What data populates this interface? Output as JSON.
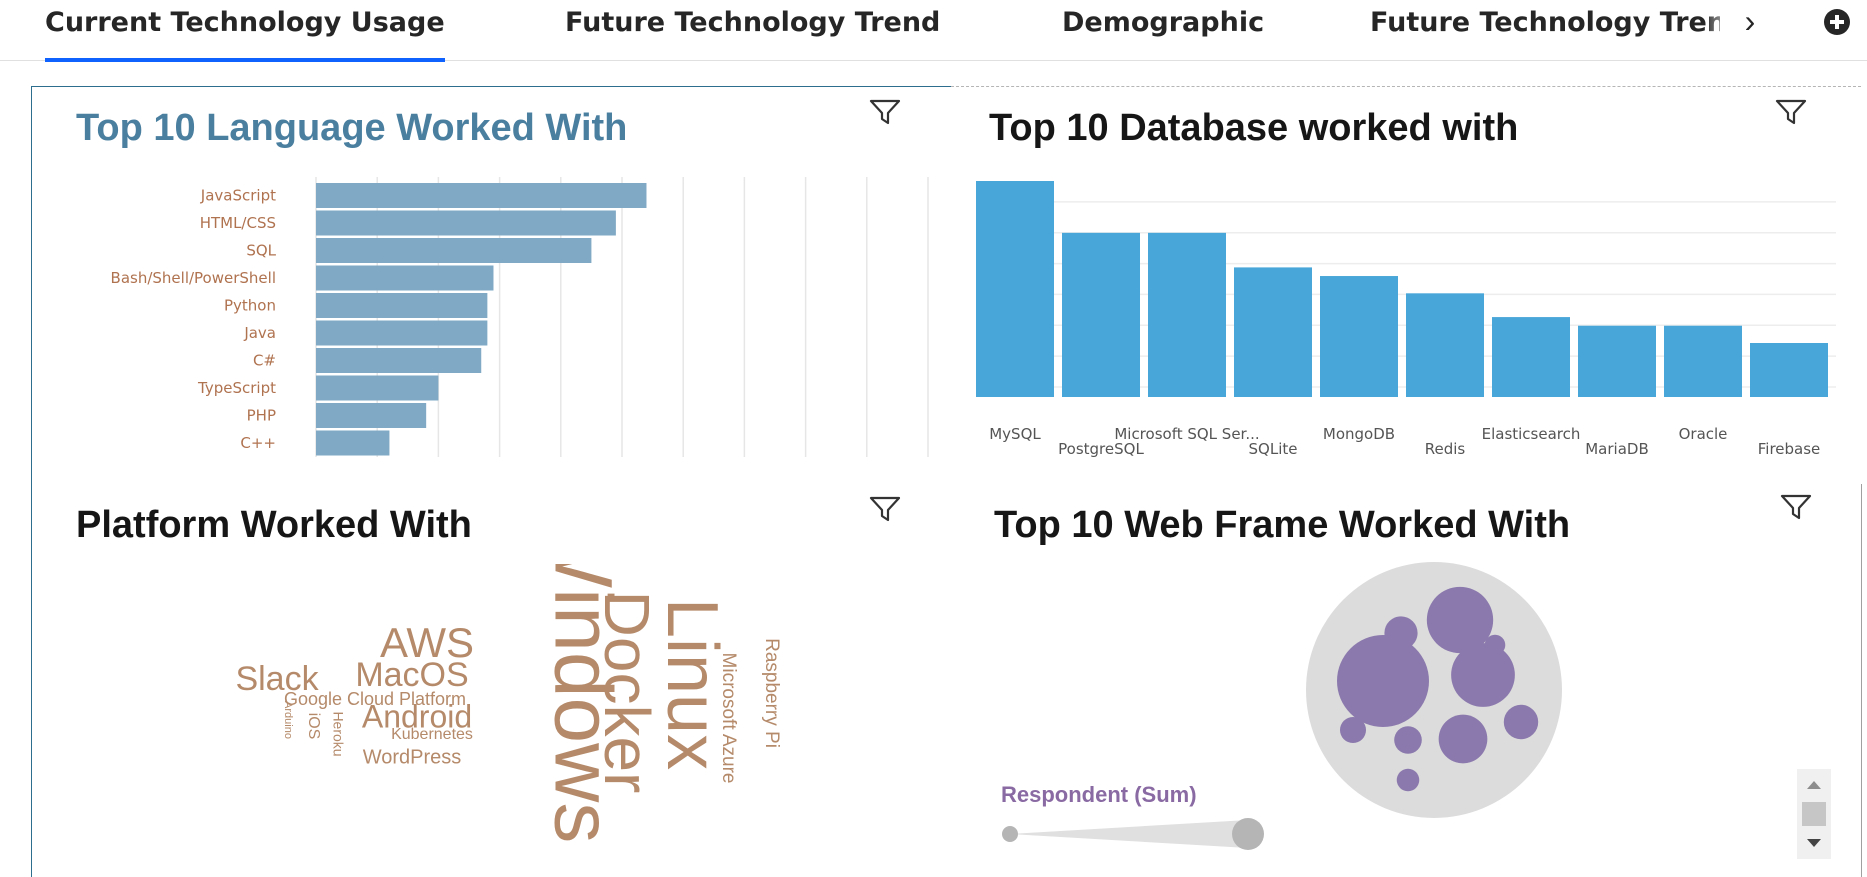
{
  "tabs": [
    {
      "label": "Current Technology Usage",
      "active": true
    },
    {
      "label": "Future Technology Trend",
      "active": false
    },
    {
      "label": "Demographic",
      "active": false
    },
    {
      "label": "Future Technology Trend",
      "active": false
    }
  ],
  "tab_controls": {
    "next_icon": "chevron-right-icon",
    "add_icon": "plus-circle-icon"
  },
  "panels": {
    "languages": {
      "title": "Top 10 Language Worked With",
      "title_color": "#4a7fa0"
    },
    "databases": {
      "title": "Top 10 Database worked with"
    },
    "platforms": {
      "title": "Platform Worked With"
    },
    "webframes": {
      "title": "Top 10 Web Frame Worked With",
      "slider_label": "Respondent (Sum)"
    }
  },
  "colors": {
    "bar_lang": "#7fa9c4",
    "bar_db": "#48a6d8",
    "wordcloud": "#b58a6a",
    "bubble": "#8b79ad",
    "pack_bg": "#dcdcdc",
    "tick_label": "#b07350"
  },
  "chart_data": [
    {
      "type": "bar",
      "orientation": "horizontal",
      "title": "Top 10 Language Worked With",
      "categories": [
        "JavaScript",
        "HTML/CSS",
        "SQL",
        "Bash/Shell/PowerShell",
        "Python",
        "Java",
        "C#",
        "TypeScript",
        "PHP",
        "C++"
      ],
      "values": [
        54,
        49,
        45,
        29,
        28,
        28,
        27,
        20,
        18,
        12
      ],
      "xlim": [
        0,
        100
      ],
      "grid": true
    },
    {
      "type": "bar",
      "title": "Top 10 Database worked with",
      "categories": [
        "MySQL",
        "PostgreSQL",
        "Microsoft SQL Ser...",
        "SQLite",
        "MongoDB",
        "Redis",
        "Elasticsearch",
        "MariaDB",
        "Oracle",
        "Firebase"
      ],
      "values": [
        100,
        76,
        76,
        60,
        56,
        48,
        37,
        33,
        33,
        25
      ],
      "ylim": [
        0,
        100
      ],
      "grid": true
    },
    {
      "type": "wordcloud",
      "title": "Platform Worked With",
      "words": [
        {
          "text": "Windows",
          "weight": 100
        },
        {
          "text": "Linux",
          "weight": 88
        },
        {
          "text": "Docker",
          "weight": 80
        },
        {
          "text": "AWS",
          "weight": 52
        },
        {
          "text": "MacOS",
          "weight": 45
        },
        {
          "text": "Slack",
          "weight": 44
        },
        {
          "text": "Android",
          "weight": 42
        },
        {
          "text": "Google Cloud Platform",
          "weight": 24
        },
        {
          "text": "Microsoft Azure",
          "weight": 24
        },
        {
          "text": "Raspberry Pi",
          "weight": 24
        },
        {
          "text": "WordPress",
          "weight": 25
        },
        {
          "text": "Kubernetes",
          "weight": 20
        },
        {
          "text": "iOS",
          "weight": 20
        },
        {
          "text": "Heroku",
          "weight": 17
        },
        {
          "text": "Arduino",
          "weight": 13
        }
      ]
    },
    {
      "type": "bubble",
      "title": "Top 10 Web Frame Worked With",
      "values": [
        100,
        52,
        48,
        28,
        9,
        8,
        14,
        13,
        5,
        6
      ]
    }
  ]
}
